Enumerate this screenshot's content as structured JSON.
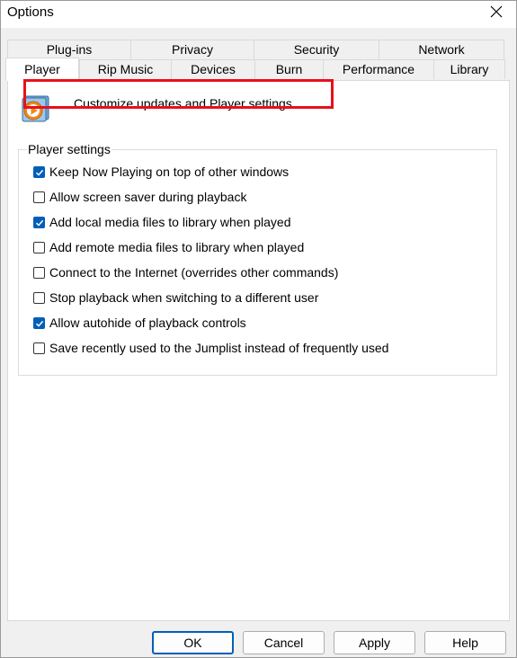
{
  "window": {
    "title": "Options"
  },
  "tabs": {
    "row1": [
      "Plug-ins",
      "Privacy",
      "Security",
      "Network"
    ],
    "row2": [
      "Player",
      "Rip Music",
      "Devices",
      "Burn",
      "Performance",
      "Library"
    ],
    "active": "Player"
  },
  "header": {
    "description": "Customize updates and Player settings."
  },
  "player_settings": {
    "group_label": "Player settings",
    "options": [
      {
        "label": "Keep Now Playing on top of other windows",
        "checked": true
      },
      {
        "label": "Allow screen saver during playback",
        "checked": false
      },
      {
        "label": "Add local media files to library when played",
        "checked": true
      },
      {
        "label": "Add remote media files to library when played",
        "checked": false
      },
      {
        "label": "Connect to the Internet (overrides other commands)",
        "checked": false
      },
      {
        "label": "Stop playback when switching to a different user",
        "checked": false
      },
      {
        "label": "Allow autohide of playback controls",
        "checked": true
      },
      {
        "label": "Save recently used to the Jumplist instead of frequently used",
        "checked": false
      }
    ]
  },
  "buttons": {
    "ok": "OK",
    "cancel": "Cancel",
    "apply": "Apply",
    "help": "Help"
  },
  "colors": {
    "highlight": "#e8101a",
    "checkbox_accent": "#005fb8"
  },
  "icons": {
    "close": "close-icon",
    "app": "media-player-icon",
    "check": "checkmark-icon"
  }
}
